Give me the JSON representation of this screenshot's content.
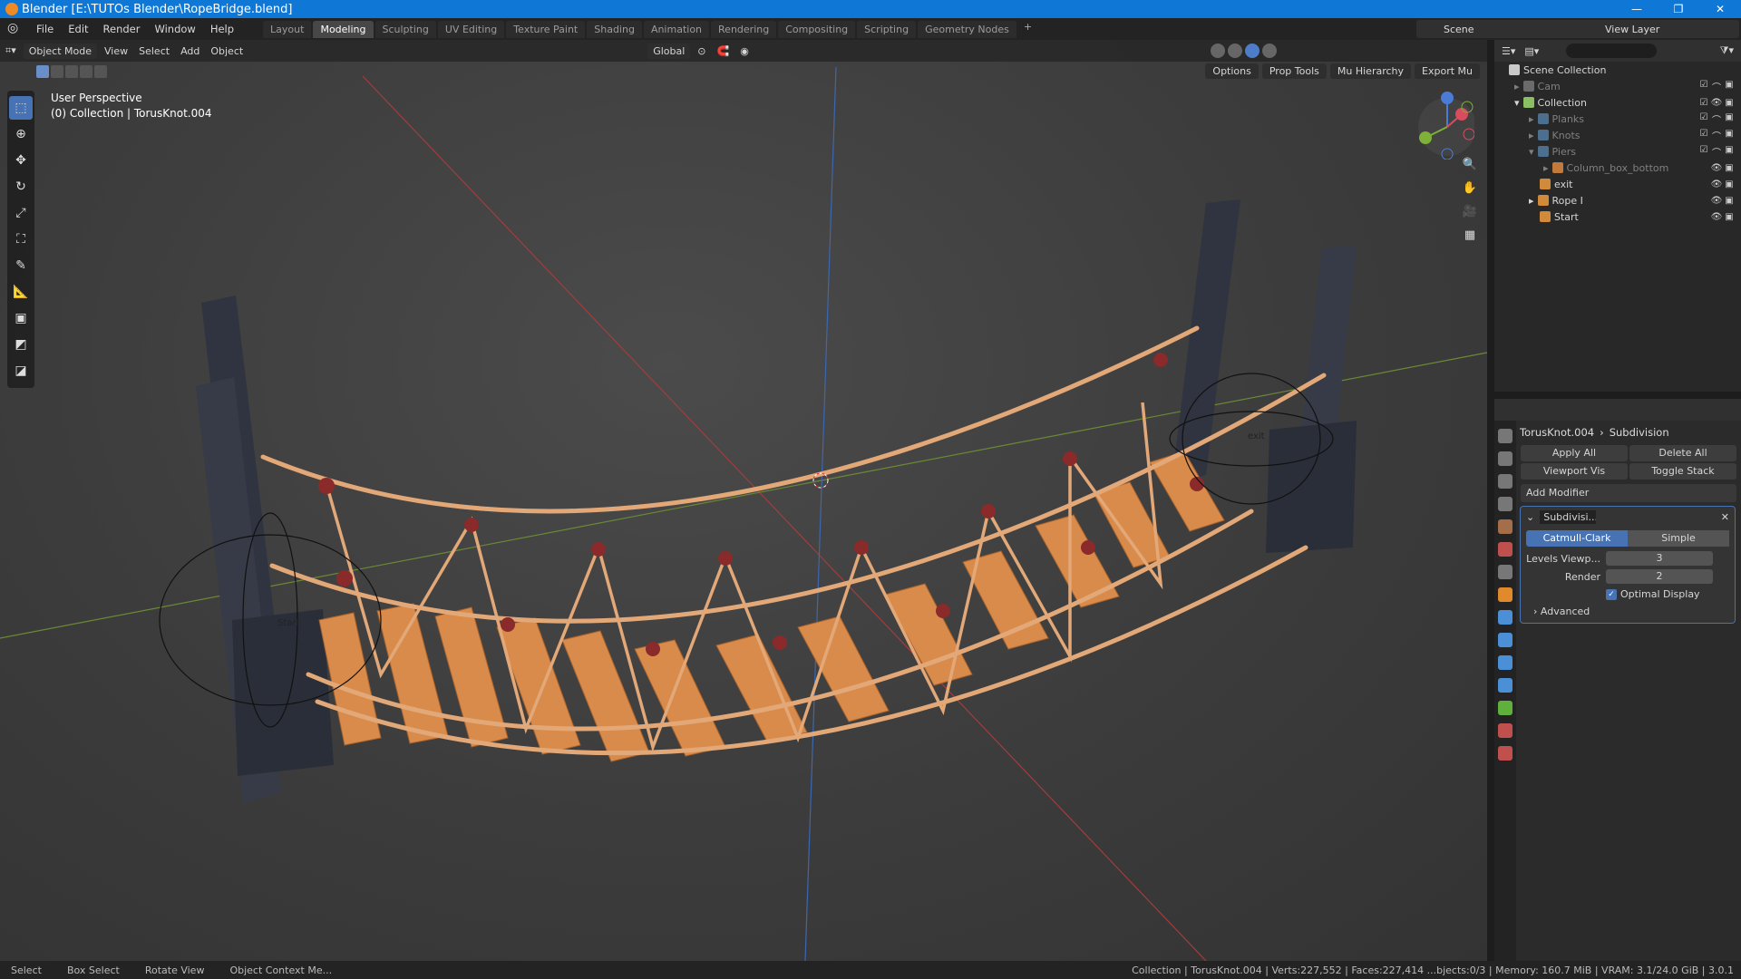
{
  "window": {
    "title": "Blender [E:\\TUTOs Blender\\RopeBridge.blend]"
  },
  "menu": [
    "File",
    "Edit",
    "Render",
    "Window",
    "Help"
  ],
  "workspaces": [
    "Layout",
    "Modeling",
    "Sculpting",
    "UV Editing",
    "Texture Paint",
    "Shading",
    "Animation",
    "Rendering",
    "Compositing",
    "Scripting",
    "Geometry Nodes"
  ],
  "active_workspace": "Modeling",
  "scene": {
    "name": "Scene",
    "view_layer": "View Layer"
  },
  "viewport": {
    "mode": "Object Mode",
    "header_menus": [
      "View",
      "Select",
      "Add",
      "Object"
    ],
    "orientation": "Global",
    "sub_dropdowns": [
      "Options",
      "Prop Tools",
      "Mu Hierarchy",
      "Export Mu"
    ],
    "info_line1": "User Perspective",
    "info_line2": "(0) Collection | TorusKnot.004",
    "empty_start": "Start",
    "empty_exit": "exit"
  },
  "outliner": {
    "scene_collection": "Scene Collection",
    "items": [
      {
        "label": "Cam",
        "dim": true
      },
      {
        "label": "Collection",
        "dim": false
      },
      {
        "label": "Planks",
        "dim": true
      },
      {
        "label": "Knots",
        "dim": true
      },
      {
        "label": "Piers",
        "dim": true
      },
      {
        "label": "Column_box_bottom",
        "dim": true
      },
      {
        "label": "exit",
        "dim": false
      },
      {
        "label": "Rope I",
        "dim": false
      },
      {
        "label": "Start",
        "dim": false
      }
    ]
  },
  "properties": {
    "object": "TorusKnot.004",
    "modifier_tab": "Subdivision",
    "apply_all": "Apply All",
    "delete_all": "Delete All",
    "viewport_vis": "Viewport Vis",
    "toggle_stack": "Toggle Stack",
    "add_modifier": "Add Modifier",
    "modifier_name": "Subdivisi...",
    "algo_catmull": "Catmull-Clark",
    "algo_simple": "Simple",
    "levels_label": "Levels Viewp...",
    "levels_value": "3",
    "render_label": "Render",
    "render_value": "2",
    "optimal_display": "Optimal Display",
    "advanced": "Advanced"
  },
  "status": {
    "select": "Select",
    "box_select": "Box Select",
    "rotate_view": "Rotate View",
    "context_menu": "Object Context Me...",
    "stats": "Collection | TorusKnot.004 | Verts:227,552 | Faces:227,414 ...bjects:0/3 | Memory: 160.7 MiB | VRAM: 3.1/24.0 GiB | 3.0.1"
  }
}
